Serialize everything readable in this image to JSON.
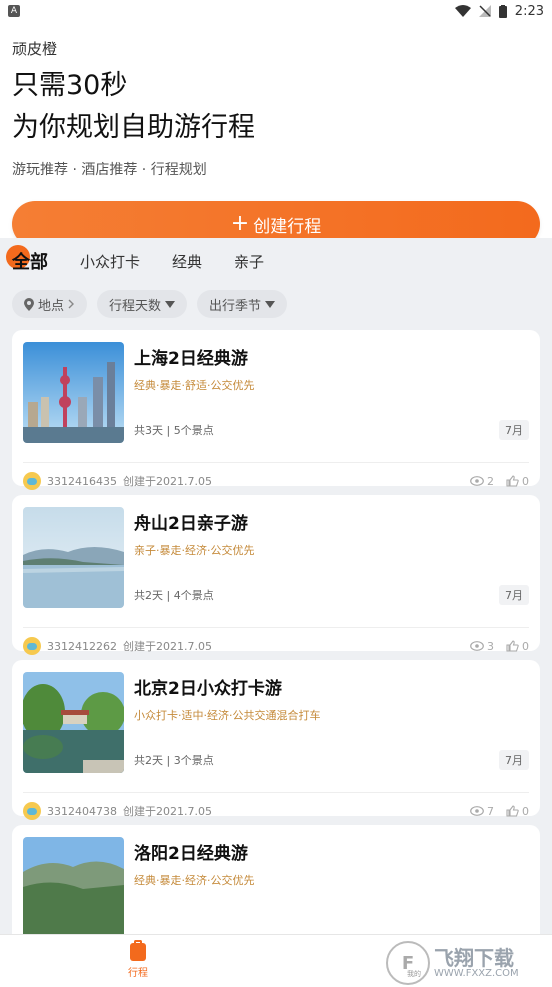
{
  "status_bar": {
    "left": "A",
    "time": "2:23"
  },
  "hero": {
    "brand": "顽皮橙",
    "headline_line1": "只需30秒",
    "headline_line2": "为你规划自助游行程",
    "subtitle": "游玩推荐 · 酒店推荐 · 行程规划",
    "create_label": "创建行程"
  },
  "tabs": [
    {
      "label": "全部",
      "active": true
    },
    {
      "label": "小众打卡"
    },
    {
      "label": "经典"
    },
    {
      "label": "亲子"
    }
  ],
  "filters": {
    "location": "地点",
    "days": "行程天数",
    "season": "出行季节"
  },
  "trips": [
    {
      "title": "上海2日经典游",
      "tags": "经典·暴走·舒适·公交优先",
      "meta": "共3天 | 5个景点",
      "month": "7月",
      "user": "3312416435",
      "created": "创建于2021.7.05",
      "views": "2",
      "likes": "0"
    },
    {
      "title": "舟山2日亲子游",
      "tags": "亲子·暴走·经济·公交优先",
      "meta": "共2天 | 4个景点",
      "month": "7月",
      "user": "3312412262",
      "created": "创建于2021.7.05",
      "views": "3",
      "likes": "0"
    },
    {
      "title": "北京2日小众打卡游",
      "tags": "小众打卡·适中·经济·公共交通混合打车",
      "meta": "共2天 | 3个景点",
      "month": "7月",
      "user": "3312404738",
      "created": "创建于2021.7.05",
      "views": "7",
      "likes": "0"
    },
    {
      "title": "洛阳2日经典游",
      "tags": "经典·暴走·经济·公交优先"
    }
  ],
  "bottom_nav": {
    "trip_label": "行程",
    "mine_label": "我的"
  },
  "watermark": {
    "text": "飞翔下载",
    "url": "WWW.FXXZ.COM"
  },
  "colors": {
    "accent": "#f36a1d",
    "tag": "#c58a3a",
    "bg": "#eef0f3"
  }
}
